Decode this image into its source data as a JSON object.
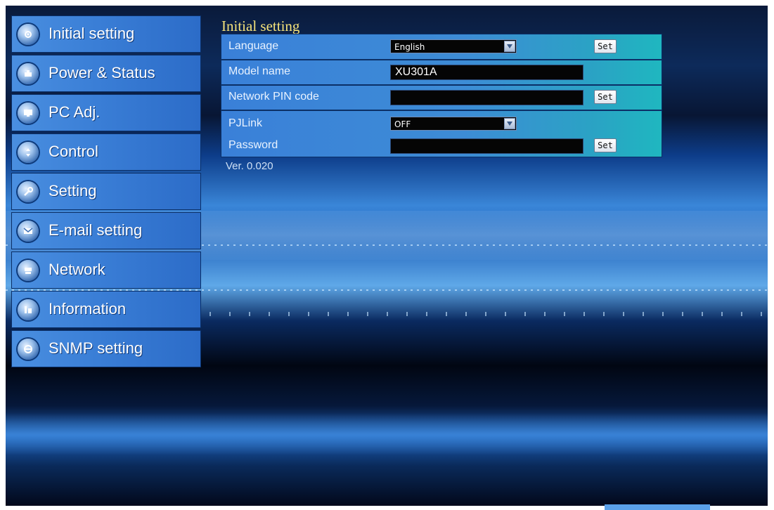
{
  "sidebar": {
    "items": [
      {
        "label": "Initial setting",
        "icon": "gear-globe-icon"
      },
      {
        "label": "Power & Status",
        "icon": "power-status-icon"
      },
      {
        "label": "PC Adj.",
        "icon": "pc-adjust-icon"
      },
      {
        "label": "Control",
        "icon": "control-icon"
      },
      {
        "label": "Setting",
        "icon": "wrench-icon"
      },
      {
        "label": "E-mail setting",
        "icon": "envelope-icon"
      },
      {
        "label": "Network",
        "icon": "network-icon"
      },
      {
        "label": "Information",
        "icon": "info-icon"
      },
      {
        "label": "SNMP setting",
        "icon": "snmp-icon"
      }
    ]
  },
  "main": {
    "title": "Initial setting",
    "rows": {
      "language": {
        "label": "Language",
        "value": "English",
        "button": "Set"
      },
      "model": {
        "label": "Model name",
        "value": "XU301A"
      },
      "pin": {
        "label": "Network PIN code",
        "value": "",
        "button": "Set"
      },
      "pjlink": {
        "label": "PJLink",
        "value": "OFF"
      },
      "password": {
        "label": "Password",
        "value": "",
        "button": "Set"
      }
    },
    "version": "Ver. 0.020"
  },
  "colors": {
    "title": "#f5e27a",
    "nav_bg": "#3a7ed6",
    "panel_bg": "#3d8cd6",
    "field_bg": "#050505"
  }
}
